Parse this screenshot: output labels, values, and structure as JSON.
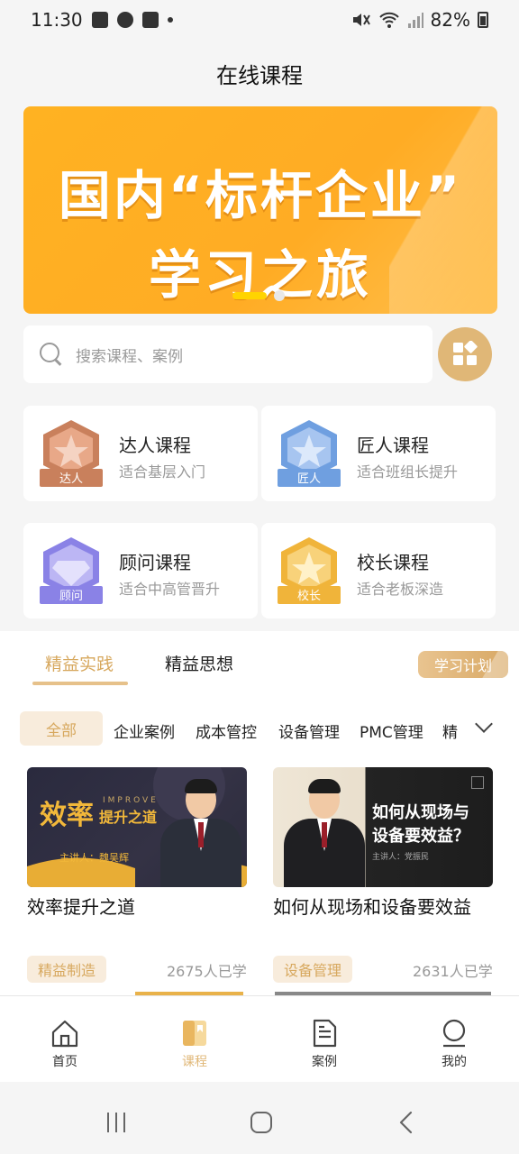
{
  "status_bar": {
    "time": "11:30",
    "battery": "82%"
  },
  "header": {
    "title": "在线课程"
  },
  "banner": {
    "line1": "国内“标杆企业”",
    "line2": "学习之旅",
    "active_index": 0,
    "total": 2
  },
  "search": {
    "placeholder": "搜索课程、案例"
  },
  "levels": [
    {
      "badge": "达人",
      "title": "达人课程",
      "subtitle": "适合基层入门",
      "color": "#c9805c"
    },
    {
      "badge": "匠人",
      "title": "匠人课程",
      "subtitle": "适合班组长提升",
      "color": "#6f9fe0"
    },
    {
      "badge": "顾问",
      "title": "顾问课程",
      "subtitle": "适合中高管晋升",
      "color": "#8a82e6"
    },
    {
      "badge": "校长",
      "title": "校长课程",
      "subtitle": "适合老板深造",
      "color": "#f0b43a"
    }
  ],
  "tabs": {
    "items": [
      "精益实践",
      "精益思想"
    ],
    "active": 0,
    "plan_button": "学习计划"
  },
  "categories": {
    "items": [
      "全部",
      "企业案例",
      "成本管控",
      "设备管理",
      "PMC管理",
      "精"
    ],
    "active": 0
  },
  "courses": [
    {
      "title": "效率提升之道",
      "cover_big": "效率",
      "cover_small": "提升之道",
      "cover_en": "IMPROVE",
      "cover_host": "主讲人：魏吴辉",
      "tag": "精益制造",
      "learners": "2675人已学"
    },
    {
      "title": "如何从现场和设备要效益",
      "cover_title_1": "如何从现场与",
      "cover_title_2": "设备要效益？",
      "cover_host": "主讲人：党振民",
      "tag": "设备管理",
      "learners": "2631人已学"
    }
  ],
  "bottom_nav": {
    "items": [
      "首页",
      "课程",
      "案例",
      "我的"
    ],
    "active": 1
  },
  "colors": {
    "accent": "#e0b777",
    "banner": "#ffaa22"
  }
}
